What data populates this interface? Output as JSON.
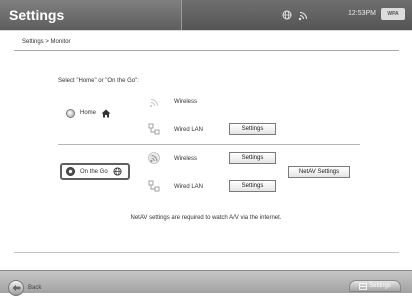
{
  "window": {
    "title": "Settings",
    "clock": "12:53PM",
    "battery_label": "WPA",
    "status_icons": [
      "globe-icon",
      "wifi-icon"
    ]
  },
  "breadcrumb": "Settings > Monitor",
  "prompt": "Select \"Home\" or \"On the Go\":",
  "home": {
    "label": "Home",
    "icon": "house-icon",
    "selected": false,
    "wireless_label": "Wireless",
    "wired_label": "Wired LAN",
    "wired_settings_label": "Settings"
  },
  "onthego": {
    "label": "On the Go",
    "icon": "globe-icon",
    "selected": true,
    "wireless_label": "Wireless",
    "wireless_settings_label": "Settings",
    "wired_label": "Wired LAN",
    "wired_settings_label": "Settings",
    "netav_settings_label": "NetAV Settings"
  },
  "note": "NetAV settings are required to watch A/V via the internet.",
  "footer": {
    "back_label": "Back",
    "settings_label": "Settings"
  },
  "colors": {
    "titlebar": "#6a6a6a",
    "accent": "#606060"
  }
}
